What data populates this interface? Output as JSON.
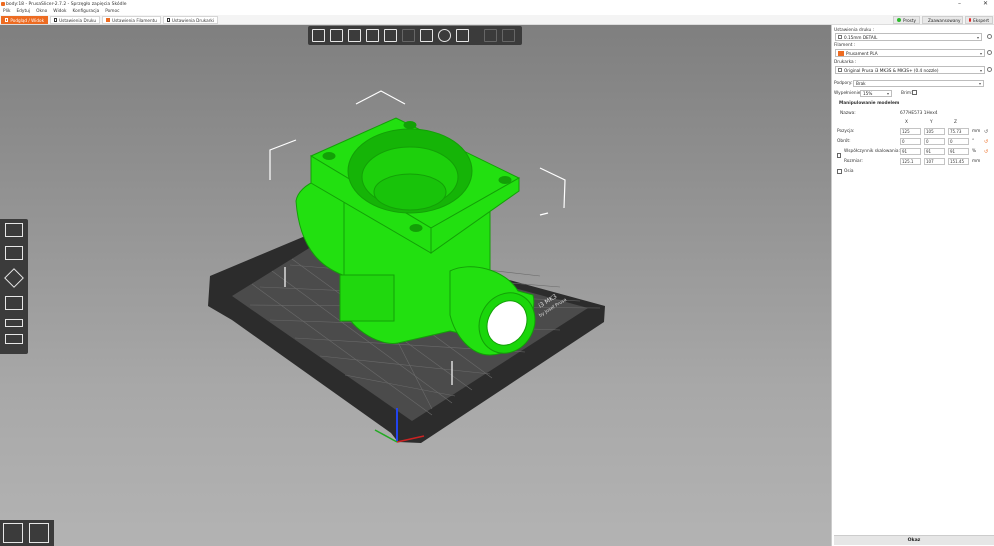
{
  "window": {
    "title": "body:18 - PrusaSlicer-2.7.2 - Sprzęgło zapięcia Skódle",
    "minimize": "–",
    "close": "✕"
  },
  "menu": [
    "Plik",
    "Edytuj",
    "Okno",
    "Widok",
    "Konfiguracja",
    "Pomoc"
  ],
  "tabs": [
    {
      "label": "Podgląd / Widok",
      "active": true
    },
    {
      "label": "Ustawienia Druku",
      "active": false
    },
    {
      "label": "Ustawienia Filamentu",
      "active": false
    },
    {
      "label": "Ustawienia Drukarki",
      "active": false
    }
  ],
  "mode_buttons": {
    "simple": "Prosty",
    "advanced": "Zaawansowany",
    "expert": "Ekspert",
    "colors": {
      "simple": "#2dbb2d",
      "advanced": "#f5c400",
      "expert": "#e02020"
    }
  },
  "sidebar": {
    "print_settings_label": "Ustawienia druku :",
    "print_profile": "0.15mm DETAIL",
    "filament_label": "Filament :",
    "filament_profile": "Prusament PLA",
    "filament_color": "#ed6b21",
    "printer_label": "Drukarka :",
    "printer_profile": "Original Prusa i3 MK3S & MK3S+ (0.4 nozzle)",
    "supports_label": "Podpory:",
    "supports_value": "Brak",
    "infill_label": "Wypełnienie:",
    "infill_value": "15%",
    "brim_label": "Brim:",
    "object_manipulation_title": "Manipulowanie modelem",
    "object_name_label": "Nazwa:",
    "object_name_value": "677HE573 1Hex4",
    "axis_x": "X",
    "axis_y": "Y",
    "axis_z": "Z",
    "position_label": "Pozycja:",
    "position": [
      "125",
      "105",
      "75.73"
    ],
    "position_unit": "mm",
    "rotation_label": "Obrót:",
    "rotation": [
      "0",
      "0",
      "0"
    ],
    "rotation_unit": "°",
    "scale_label": "Współczynnik skalowania:",
    "scale": [
      "91",
      "91",
      "91"
    ],
    "scale_unit": "%",
    "size_label": "Rozmiar:",
    "size": [
      "125.1",
      "107",
      "151.45"
    ],
    "size_unit": "mm",
    "drop_label": "Osia",
    "slice_button": "Okaz"
  },
  "bed": {
    "label_line1": "i3 MK3",
    "label_line2": "by Josef Prusa"
  }
}
